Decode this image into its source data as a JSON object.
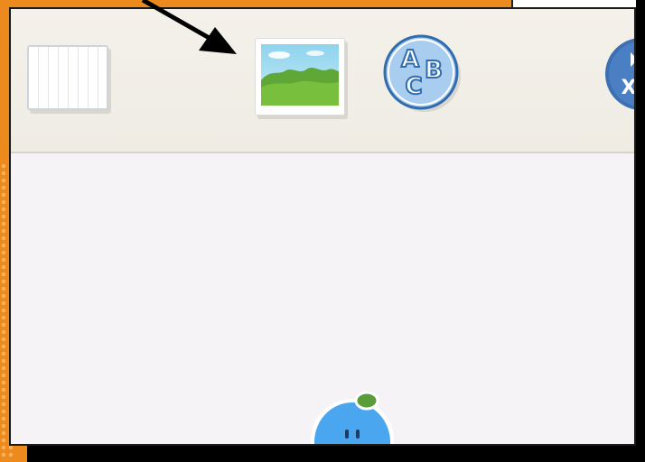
{
  "toolbar": {
    "tools": [
      {
        "name": "blank-page-tool",
        "icon": "blank-page-icon"
      },
      {
        "name": "image-tool",
        "icon": "landscape-image-icon"
      },
      {
        "name": "abc-letters-tool",
        "icon": "abc-letters-icon",
        "glyphs": [
          "A",
          "B",
          "C"
        ]
      },
      {
        "name": "clear-tool",
        "icon": "x-icon",
        "glyph": "X"
      }
    ]
  },
  "annotation": {
    "icon": "pointer-arrow-icon"
  },
  "mascot": {
    "icon": "blue-blob-mascot-icon"
  },
  "colors": {
    "frame": "#ec8a1e",
    "toolbar": "#f4f1ea",
    "canvas": "#f5f3f6",
    "badge_blue": "#a9cdef",
    "mascot_blue": "#4aa6ee",
    "leaf_green": "#5a9b3a"
  }
}
